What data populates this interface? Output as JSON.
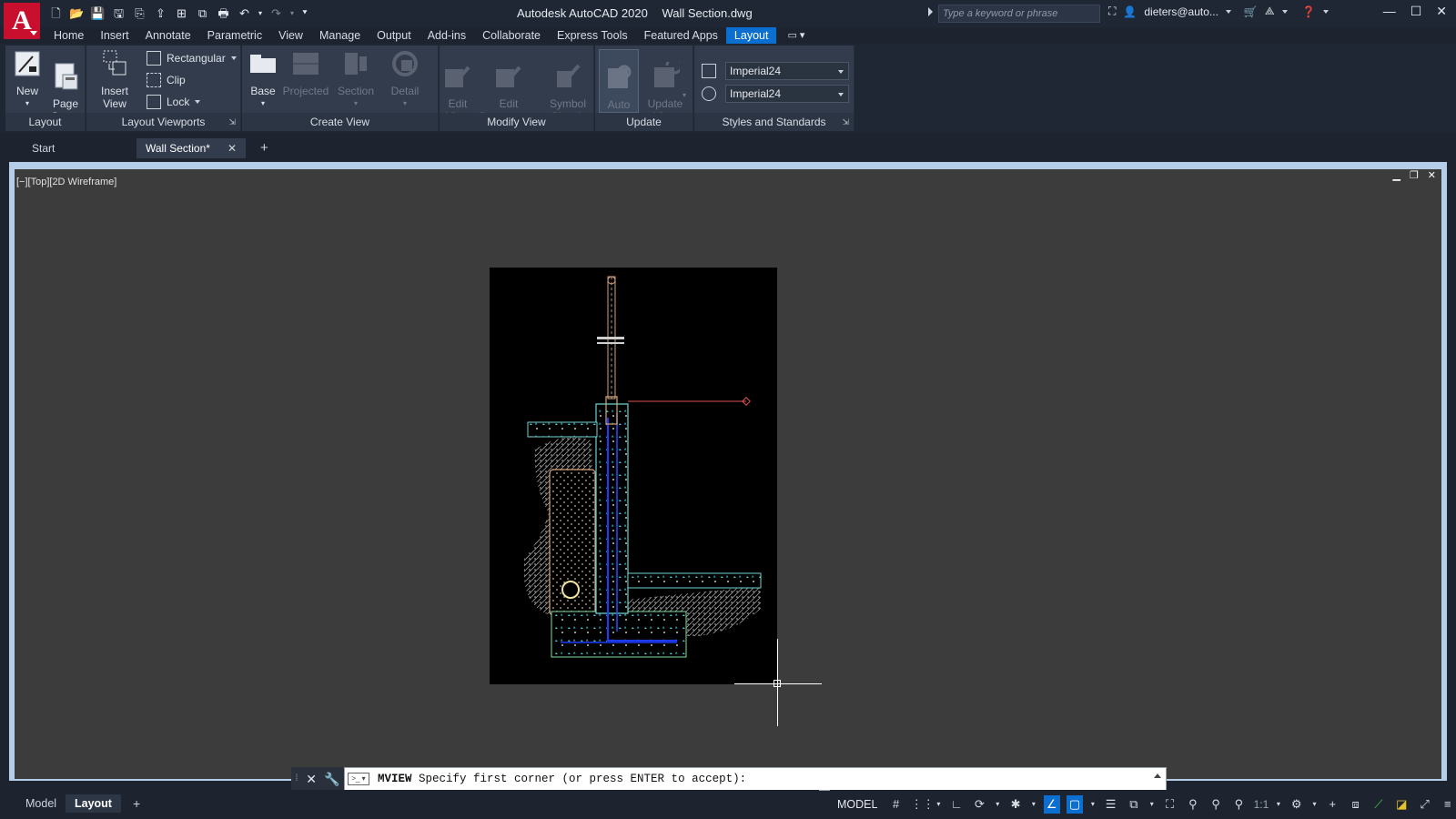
{
  "app": {
    "logo_letter": "A",
    "title": "Autodesk AutoCAD 2020",
    "document": "Wall Section.dwg"
  },
  "search": {
    "placeholder": "Type a keyword or phrase"
  },
  "user": {
    "name": "dieters@auto..."
  },
  "ribbon_tabs": [
    "Home",
    "Insert",
    "Annotate",
    "Parametric",
    "View",
    "Manage",
    "Output",
    "Add-ins",
    "Collaborate",
    "Express Tools",
    "Featured Apps",
    "Layout"
  ],
  "active_ribbon_tab": "Layout",
  "ribbon": {
    "layout_panel": {
      "title": "Layout",
      "new_label": "New",
      "page_setup_label": "Page\nSetup"
    },
    "viewports_panel": {
      "title": "Layout Viewports",
      "insert_view_label": "Insert View",
      "rectangular_label": "Rectangular",
      "clip_label": "Clip",
      "lock_label": "Lock"
    },
    "create_view_panel": {
      "title": "Create View",
      "base_label": "Base",
      "projected_label": "Projected",
      "section_label": "Section",
      "detail_label": "Detail"
    },
    "modify_view_panel": {
      "title": "Modify View",
      "edit_view_label": "Edit\nView",
      "edit_components_label": "Edit\nComponents",
      "symbol_sketch_label": "Symbol\nSketch"
    },
    "update_panel": {
      "title": "Update",
      "auto_update_label": "Auto\nUpdate",
      "update_view_label": "Update\nView"
    },
    "styles_panel": {
      "title": "Styles and Standards",
      "standard_1": "Imperial24",
      "standard_2": "Imperial24"
    }
  },
  "doc_tabs": {
    "start": "Start",
    "active": "Wall Section*",
    "close": "✕",
    "add": "+"
  },
  "viewport": {
    "label": "[−][Top][2D Wireframe]"
  },
  "command_line": {
    "command": "MVIEW",
    "prompt": " Specify first corner (or press ENTER to accept):"
  },
  "layout_tabs": {
    "model": "Model",
    "layout": "Layout",
    "add": "+"
  },
  "status_bar": {
    "model": "MODEL",
    "scale": "1:1"
  },
  "colors": {
    "ribbon_panel": "#323c4c",
    "active_tab": "#0a6fd1",
    "drawing_bg": "#3c3c3c",
    "paper": "#000000",
    "concrete_outline": "#6fd3d3",
    "rebar": "#1e3cff",
    "brick": "#d9a57a",
    "leader": "#e05050"
  }
}
